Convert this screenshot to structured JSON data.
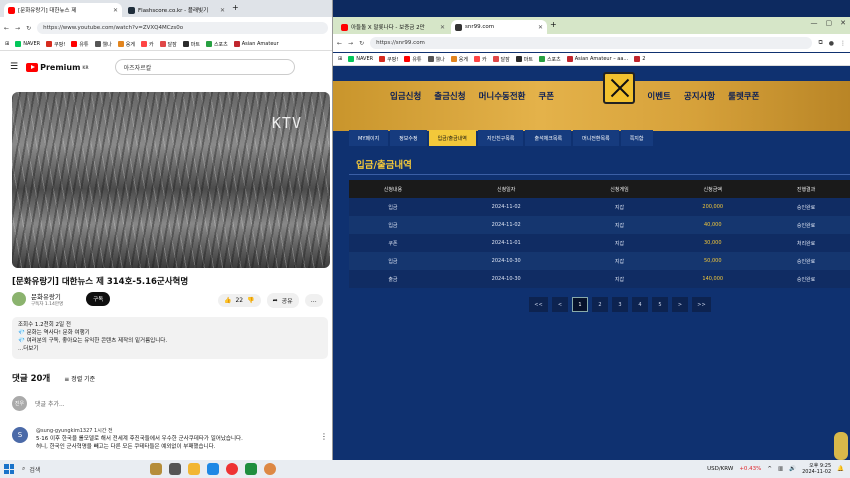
{
  "left": {
    "tabs": [
      {
        "title": "[문화유랑기] 대한뉴스 제",
        "color": "#ff0000"
      },
      {
        "title": "Flashscore.co.kr - 플래빛기",
        "color": "#1f2d3a"
      }
    ],
    "url": "https://www.youtube.com/watch?v=ZVXQ4MCzs0o",
    "bookmarks": [
      {
        "label": "NAVER",
        "color": "#03c75a"
      },
      {
        "label": "쿠팡!",
        "color": "#d52b1e"
      },
      {
        "label": "유튜",
        "color": "#ff0000"
      },
      {
        "label": "웰나",
        "color": "#555555"
      },
      {
        "label": "웅게",
        "color": "#e2851e"
      },
      {
        "label": "카",
        "color": "#ff4545"
      },
      {
        "label": "달잠",
        "color": "#e04848"
      },
      {
        "label": "마트",
        "color": "#2b2b2b"
      },
      {
        "label": "스포츠",
        "color": "#27a041"
      },
      {
        "label": "Asian Amateur",
        "color": "#c0262d"
      }
    ],
    "yt": {
      "logo": "Premium",
      "logo_sup": "KR",
      "search": "아즈자르칼",
      "title": "[문화유랑기] 대한뉴스 제 314호-5.16군사혁명",
      "channel": "문화유랑기",
      "subscribers": "구독자 1.14만명",
      "subscribe": "구독",
      "likes": "22",
      "share": "공유",
      "desc": [
        "조회수 1.2천회  2일 전",
        "💎 문화는 역사다! 문화 여행기",
        "💎 여러분의 구독, 좋아요는 유익한 콘텐츠 제작의 밑거름입니다.",
        "...더보기"
      ],
      "video_watermark": "KTV",
      "comments_count": "댓글 20개",
      "sort": "정렬 기준",
      "comment_avatar": "진우",
      "comment_placeholder": "댓글 추가...",
      "comment": {
        "avatar": "S",
        "author": "@sung-gyungkim1327  1시간 전",
        "lines": [
          "5·16 이후 한국을 롤모델로 해서 전세계 후진국들에서 우수한 군사쿠데타가 일어났습니다.",
          "허니, 한국인 군사혁명을 빼고는 다른 모든 쿠테타들은 예외없이 부패했습니다."
        ]
      }
    }
  },
  "right": {
    "tabs": [
      {
        "title": "아들돌 X 말롯나다 - 보증금 2만",
        "color": "#ff0000"
      },
      {
        "title": "snr99.com",
        "color": "#333333"
      }
    ],
    "url": "https://snr99.com",
    "bookmarks": [
      {
        "label": "NAVER",
        "color": "#03c75a"
      },
      {
        "label": "쿠팡!",
        "color": "#d52b1e"
      },
      {
        "label": "유튜",
        "color": "#ff0000"
      },
      {
        "label": "웰나",
        "color": "#555555"
      },
      {
        "label": "웅게",
        "color": "#e2851e"
      },
      {
        "label": "카",
        "color": "#ff4545"
      },
      {
        "label": "달잠",
        "color": "#e04848"
      },
      {
        "label": "마트",
        "color": "#2b2b2b"
      },
      {
        "label": "스포츠",
        "color": "#27a041"
      },
      {
        "label": "Asian Amateur – aa...",
        "color": "#c0262d"
      },
      {
        "label": "2",
        "color": "#c0262d"
      }
    ],
    "menu": [
      "입금신청",
      "출금신청",
      "머니수동전환",
      "쿠폰",
      "콤프신청",
      "이벤트",
      "공지사항",
      "룰렛쿠폰"
    ],
    "subnav": [
      "MY페이지",
      "정보수정",
      "입금/출금내역",
      "지인친구목록",
      "출석체크목록",
      "머니전환목록",
      "쪽지함"
    ],
    "subnav_active": 2,
    "section_title": "입금/출금내역",
    "table": {
      "headers": [
        "신청내용",
        "신청일자",
        "신청게임",
        "신청금액",
        "진행결과"
      ],
      "rows": [
        [
          "입금",
          "2024-11-02",
          "지갑",
          "200,000",
          "승인완료"
        ],
        [
          "입금",
          "2024-11-02",
          "지갑",
          "40,000",
          "승인완료"
        ],
        [
          "쿠폰",
          "2024-11-01",
          "지갑",
          "30,000",
          "처리완료"
        ],
        [
          "입금",
          "2024-10-30",
          "지갑",
          "50,000",
          "승인완료"
        ],
        [
          "출금",
          "2024-10-30",
          "지갑",
          "140,000",
          "승인완료"
        ]
      ]
    },
    "pager": [
      "<<",
      "<",
      "1",
      "2",
      "3",
      "4",
      "5",
      ">",
      ">>"
    ]
  },
  "taskbar": {
    "search": "검색",
    "ticker": "USD/KRW",
    "ticker_change": "+0.43%",
    "ticker_color": "#e0282e",
    "time": "오후 9:25",
    "date": "2024-11-02"
  }
}
